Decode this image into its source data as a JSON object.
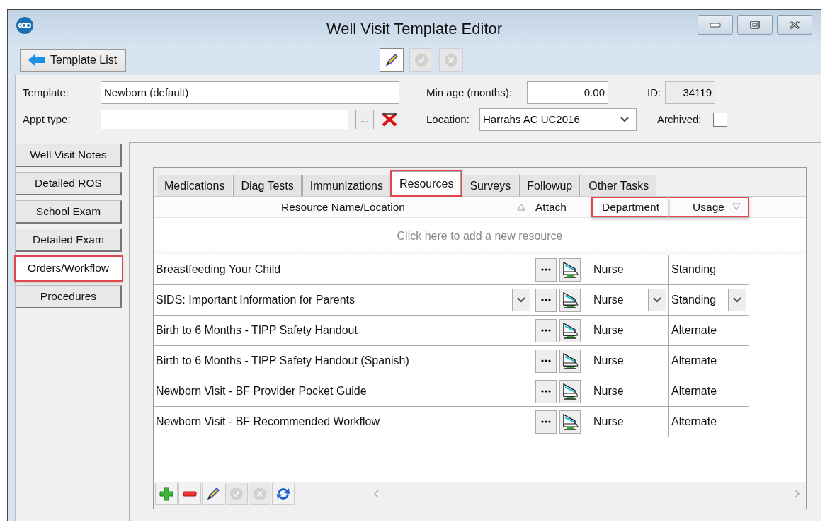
{
  "window": {
    "title": "Well Visit Template Editor"
  },
  "toolbar": {
    "back_button": "Template List",
    "actions": [
      {
        "kind": "edit",
        "disabled": false
      },
      {
        "kind": "accept",
        "disabled": true
      },
      {
        "kind": "cancel",
        "disabled": true
      }
    ]
  },
  "form": {
    "template": {
      "label": "Template:",
      "value": "Newborn (default)"
    },
    "appt_type": {
      "label": "Appt type:",
      "browse": "..."
    },
    "min_age": {
      "label": "Min age (months):",
      "value": "0.00"
    },
    "id": {
      "label": "ID:",
      "value": "34119"
    },
    "location": {
      "label": "Location:",
      "value": "Harrahs AC UC2016"
    },
    "archived": {
      "label": "Archived:",
      "checked": false
    }
  },
  "sidebar": {
    "items": [
      {
        "label": "Well Visit Notes",
        "selected": false,
        "highlighted": false
      },
      {
        "label": "Detailed ROS",
        "selected": false,
        "highlighted": false
      },
      {
        "label": "School Exam",
        "selected": false,
        "highlighted": false
      },
      {
        "label": "Detailed Exam",
        "selected": false,
        "highlighted": false
      },
      {
        "label": "Orders/Workflow",
        "selected": true,
        "highlighted": true
      },
      {
        "label": "Procedures",
        "selected": false,
        "highlighted": false
      }
    ]
  },
  "tabs": [
    {
      "label": "Medications",
      "selected": false,
      "highlighted": false
    },
    {
      "label": "Diag Tests",
      "selected": false,
      "highlighted": false
    },
    {
      "label": "Immunizations",
      "selected": false,
      "highlighted": false
    },
    {
      "label": "Resources",
      "selected": true,
      "highlighted": true
    },
    {
      "label": "Surveys",
      "selected": false,
      "highlighted": false
    },
    {
      "label": "Followup",
      "selected": false,
      "highlighted": false
    },
    {
      "label": "Other Tasks",
      "selected": false,
      "highlighted": false
    }
  ],
  "table": {
    "columns": [
      {
        "label": "Resource Name/Location",
        "sorted": true,
        "descending": false,
        "highlighted": false
      },
      {
        "label": "Attach",
        "sorted": false,
        "highlighted": false
      },
      {
        "label": "Department",
        "sorted": false,
        "highlighted": true
      },
      {
        "label": "Usage",
        "sorted": true,
        "descending": true,
        "highlighted": true
      }
    ],
    "add_row": "Click here to add a new resource",
    "rows": [
      {
        "name": "Breastfeeding Your Child",
        "department": "Nurse",
        "usage": "Standing",
        "editing": false
      },
      {
        "name": "SIDS: Important Information for Parents",
        "department": "Nurse",
        "usage": "Standing",
        "editing": true
      },
      {
        "name": "Birth to 6 Months - TIPP Safety Handout",
        "department": "Nurse",
        "usage": "Alternate",
        "editing": false
      },
      {
        "name": "Birth to 6 Months - TIPP Safety Handout (Spanish)",
        "department": "Nurse",
        "usage": "Alternate",
        "editing": false
      },
      {
        "name": "Newborn Visit - BF Provider Pocket Guide",
        "department": "Nurse",
        "usage": "Alternate",
        "editing": false
      },
      {
        "name": "Newborn Visit - BF Recommended Workflow",
        "department": "Nurse",
        "usage": "Alternate",
        "editing": false
      }
    ]
  },
  "bottom_toolbar": [
    {
      "kind": "add",
      "disabled": false
    },
    {
      "kind": "remove",
      "disabled": false
    },
    {
      "kind": "edit",
      "disabled": false
    },
    {
      "kind": "accept",
      "disabled": true
    },
    {
      "kind": "cancel",
      "disabled": true
    },
    {
      "kind": "refresh",
      "disabled": false
    }
  ]
}
